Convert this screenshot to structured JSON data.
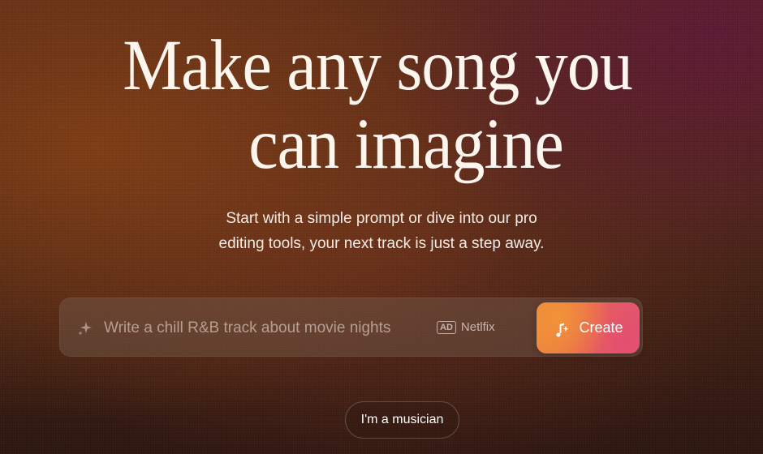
{
  "hero": {
    "title_line1": "Make any song you",
    "title_line2": "can imagine",
    "subtitle_line1": "Start with a simple prompt or dive into our pro",
    "subtitle_line2": "editing tools, your next track is just a step away."
  },
  "prompt": {
    "placeholder": "Write a chill R&B track about movie nights",
    "value": "",
    "ad_badge": "AD",
    "ad_label": "Netlfix",
    "create_label": "Create"
  },
  "secondary": {
    "musician_label": "I'm a musician"
  },
  "icons": {
    "prompt_icon": "sparkle-icon",
    "create_icon": "music-note-sparkle-icon"
  },
  "colors": {
    "accent_start": "#f08a3a",
    "accent_end": "#e2537a",
    "headline": "#fdf6ee"
  }
}
